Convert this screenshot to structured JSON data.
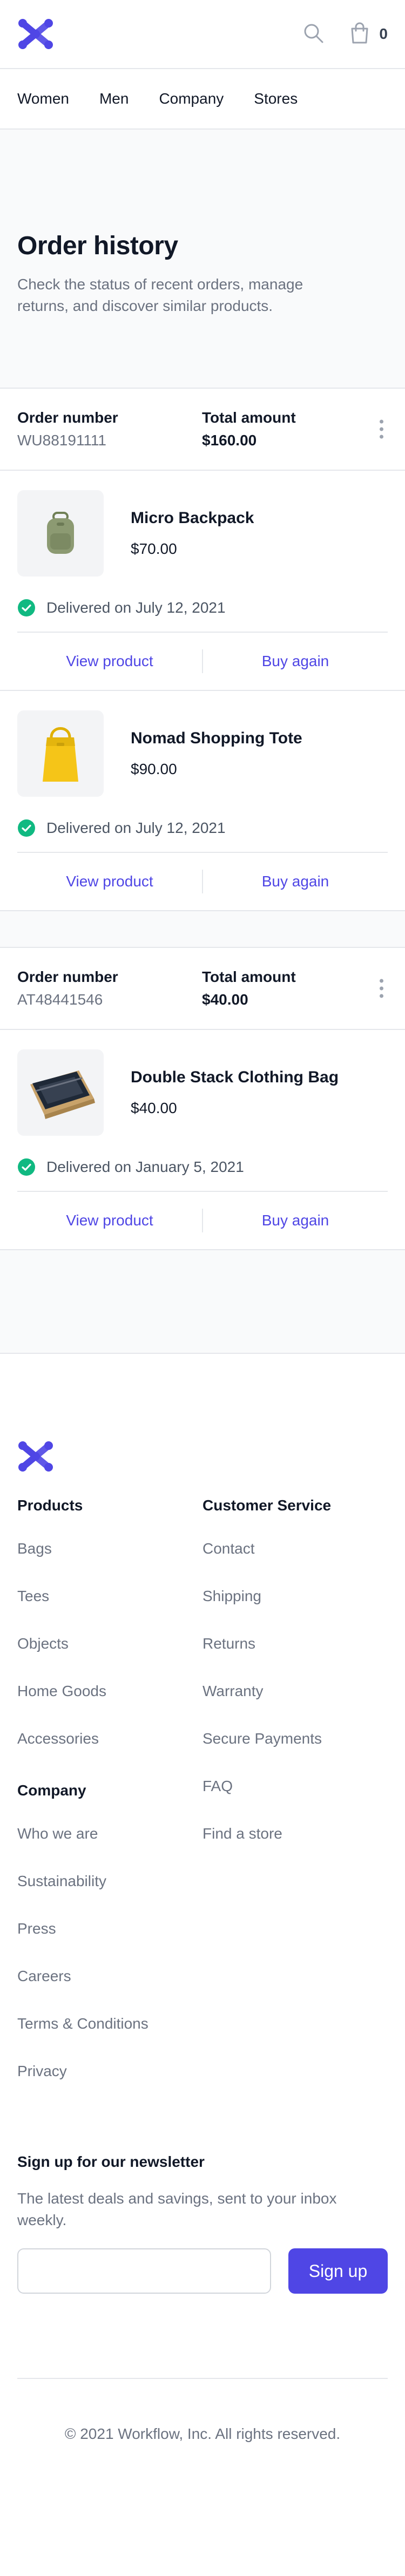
{
  "header": {
    "cart_count": "0"
  },
  "nav": {
    "items": [
      "Women",
      "Men",
      "Company",
      "Stores"
    ]
  },
  "hero": {
    "title": "Order history",
    "description": "Check the status of recent orders, manage returns, and discover similar products."
  },
  "orders": [
    {
      "number_label": "Order number",
      "number": "WU88191111",
      "total_label": "Total amount",
      "total": "$160.00",
      "products": [
        {
          "name": "Micro Backpack",
          "price": "$70.00",
          "status": "Delivered on July 12, 2021",
          "view_label": "View product",
          "buy_label": "Buy again",
          "image": "green-backpack"
        },
        {
          "name": "Nomad Shopping Tote",
          "price": "$90.00",
          "status": "Delivered on July 12, 2021",
          "view_label": "View product",
          "buy_label": "Buy again",
          "image": "yellow-tote"
        }
      ]
    },
    {
      "number_label": "Order number",
      "number": "AT48441546",
      "total_label": "Total amount",
      "total": "$40.00",
      "products": [
        {
          "name": "Double Stack Clothing Bag",
          "price": "$40.00",
          "status": "Delivered on January 5, 2021",
          "view_label": "View product",
          "buy_label": "Buy again",
          "image": "clothing-bag"
        }
      ]
    }
  ],
  "footer": {
    "products_heading": "Products",
    "products": [
      "Bags",
      "Tees",
      "Objects",
      "Home Goods",
      "Accessories"
    ],
    "company_heading": "Company",
    "company": [
      "Who we are",
      "Sustainability",
      "Press",
      "Careers",
      "Terms & Conditions",
      "Privacy"
    ],
    "service_heading": "Customer Service",
    "service": [
      "Contact",
      "Shipping",
      "Returns",
      "Warranty",
      "Secure Payments",
      "FAQ",
      "Find a store"
    ],
    "newsletter_heading": "Sign up for our newsletter",
    "newsletter_text": "The latest deals and savings, sent to your inbox weekly.",
    "signup_label": "Sign up",
    "email_value": "",
    "copyright": "© 2021 Workflow, Inc. All rights reserved."
  },
  "colors": {
    "accent": "#4f46e5",
    "success": "#10b981"
  }
}
